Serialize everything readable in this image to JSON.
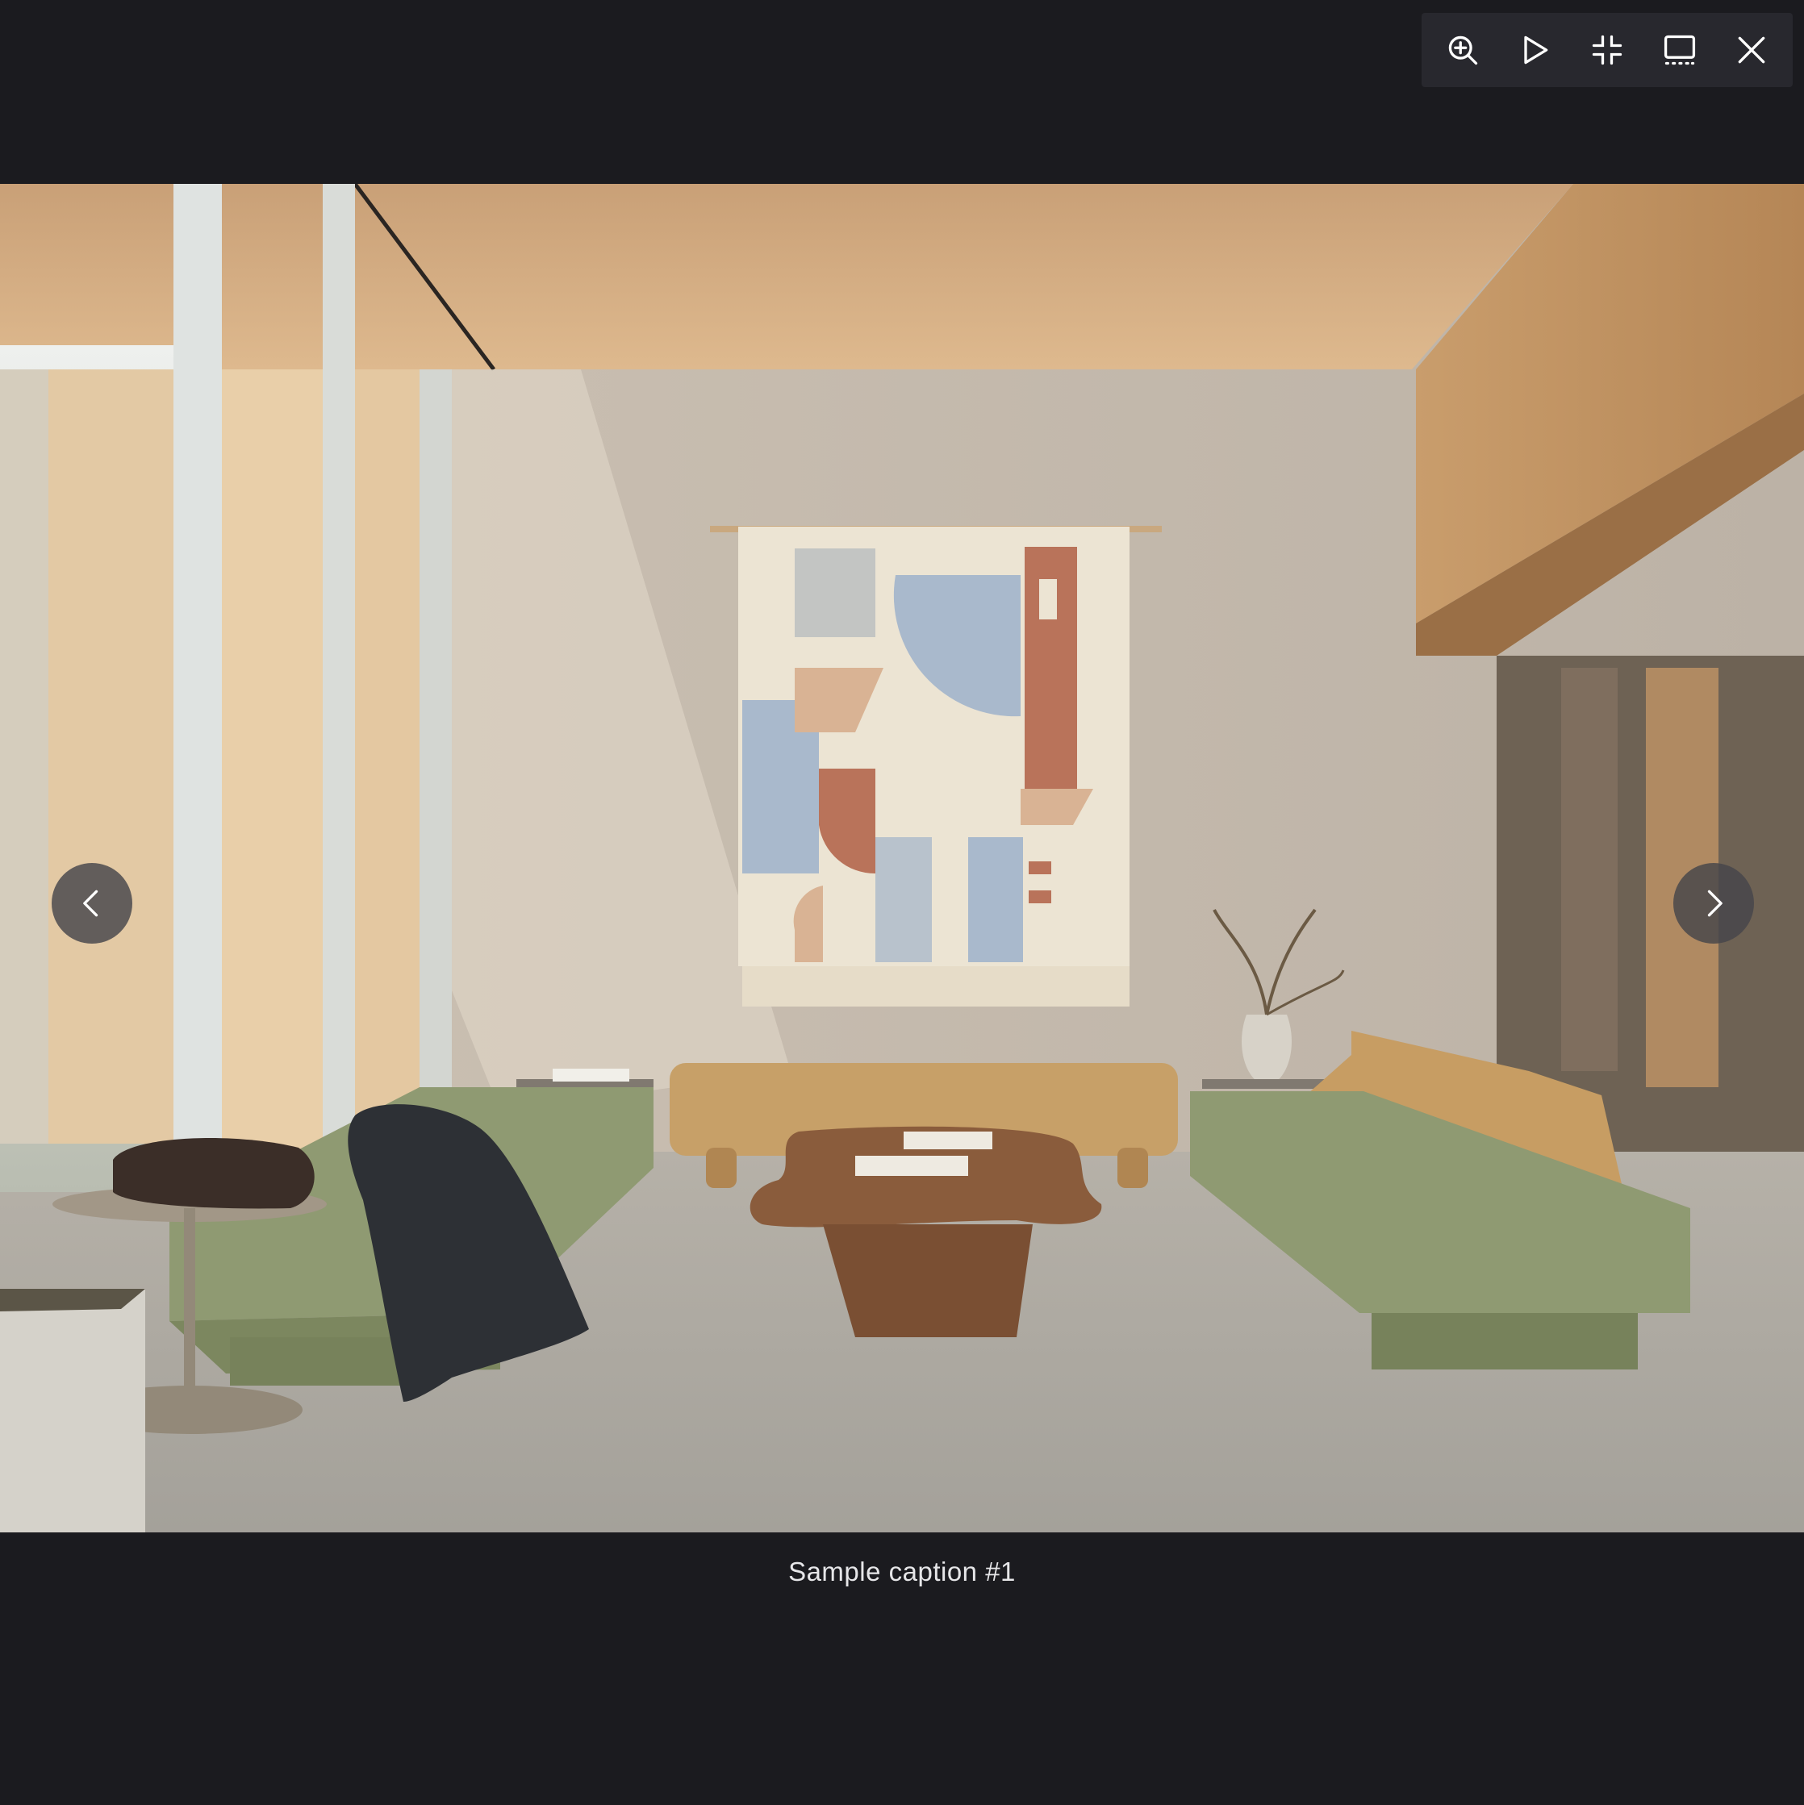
{
  "toolbar": {
    "buttons": [
      {
        "icon": "zoom-in-icon",
        "action": "zoom-in"
      },
      {
        "icon": "play-icon",
        "action": "slideshow"
      },
      {
        "icon": "exit-fullscreen-icon",
        "action": "exit-fullscreen"
      },
      {
        "icon": "thumbnails-icon",
        "action": "thumbnails"
      },
      {
        "icon": "close-icon",
        "action": "close"
      }
    ]
  },
  "navigation": {
    "prev_icon": "chevron-left-icon",
    "next_icon": "chevron-right-icon"
  },
  "caption": {
    "text": "Sample caption #1"
  },
  "colors": {
    "background": "#1b1b1f",
    "toolbar": "#28282e",
    "icon": "#ffffff",
    "arrow_bg": "#46464a"
  }
}
